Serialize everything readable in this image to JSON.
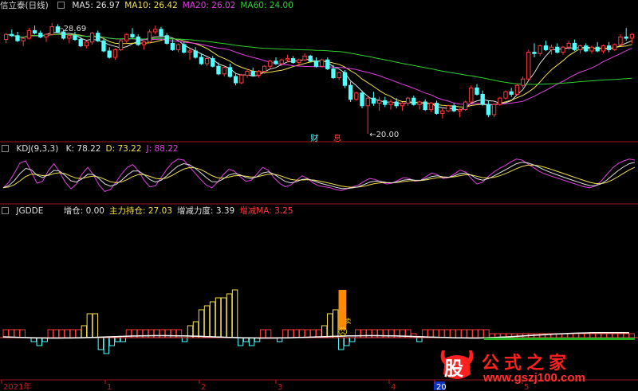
{
  "colors": {
    "up": "#ff3a3a",
    "down": "#54ffff",
    "ma5": "#e0e0e0",
    "ma10": "#f2e04a",
    "ma20": "#e040e0",
    "ma60": "#30d030",
    "kdj_k": "#e0e0e0",
    "kdj_d": "#f2e04a",
    "kdj_j": "#e040e0",
    "separator": "#a01818",
    "axis_text": "#c02020"
  },
  "main_panel": {
    "title": "信立泰(日线)",
    "indicators": [
      {
        "label": "MA5: 26.97",
        "color": "#e0e0e0"
      },
      {
        "label": "MA10: 26.42",
        "color": "#f2e04a"
      },
      {
        "label": "MA20: 26.02",
        "color": "#e040e0"
      },
      {
        "label": "MA60: 24.00",
        "color": "#30d030"
      }
    ],
    "high_marker": "28.69",
    "low_marker": "20.00",
    "event_labels": [
      {
        "text": "财",
        "color": "#54ffff"
      },
      {
        "text": "息",
        "color": "#ff3a3a"
      }
    ]
  },
  "kdj_panel": {
    "title": "KDJ(9,3,3)",
    "indicators": [
      {
        "label": "K: 78.22",
        "color": "#e0e0e0"
      },
      {
        "label": "D: 73.22",
        "color": "#f2e04a"
      },
      {
        "label": "J: 88.22",
        "color": "#e040e0"
      }
    ]
  },
  "jgdde_panel": {
    "title": "JGDDE",
    "indicators": [
      {
        "label": "增仓: 0.00",
        "color": "#e0e0e0"
      },
      {
        "label": "主力持仓: 27.03",
        "color": "#f2e04a"
      },
      {
        "label": "增减力度: 3.39",
        "color": "#e0e0e0"
      },
      {
        "label": "增减MA: 3.25",
        "color": "#ff3a3a"
      }
    ],
    "marker_glyph": "☹",
    "marker_label": "卖"
  },
  "time_axis": {
    "labels": [
      "2021年",
      "1",
      "2",
      "3",
      "4",
      "20",
      "5"
    ],
    "highlight_index": 5
  },
  "watermark": {
    "logo_char": "股",
    "text": "公式之家",
    "url": "www.gszj100.com"
  },
  "chart_data": {
    "type": "candlestick",
    "title": "信立泰(日线)",
    "price_range": [
      19.5,
      29.5
    ],
    "anchors": {
      "high": 28.69,
      "low": 20.0
    },
    "ma_last": {
      "MA5": 26.97,
      "MA10": 26.42,
      "MA20": 26.02,
      "MA60": 24.0
    },
    "candles": [
      [
        27.4,
        27.9,
        27.1,
        27.8
      ],
      [
        27.8,
        28.2,
        27.6,
        27.7
      ],
      [
        27.7,
        28.0,
        27.2,
        27.3
      ],
      [
        27.3,
        27.6,
        26.9,
        27.5
      ],
      [
        27.5,
        28.3,
        27.4,
        28.1
      ],
      [
        28.1,
        28.5,
        27.8,
        27.9
      ],
      [
        27.9,
        28.1,
        27.5,
        27.6
      ],
      [
        27.6,
        27.9,
        27.2,
        27.8
      ],
      [
        27.8,
        28.69,
        27.7,
        28.4
      ],
      [
        28.4,
        28.6,
        27.9,
        28.0
      ],
      [
        28.0,
        28.2,
        27.4,
        27.5
      ],
      [
        27.5,
        27.8,
        27.1,
        27.7
      ],
      [
        27.7,
        28.0,
        27.3,
        27.4
      ],
      [
        27.4,
        27.6,
        26.8,
        26.9
      ],
      [
        26.9,
        27.3,
        26.7,
        27.2
      ],
      [
        27.2,
        28.0,
        27.0,
        27.9
      ],
      [
        27.9,
        28.1,
        27.2,
        27.3
      ],
      [
        27.3,
        27.5,
        26.4,
        26.5
      ],
      [
        26.5,
        26.8,
        25.9,
        26.0
      ],
      [
        26.0,
        26.7,
        25.8,
        26.6
      ],
      [
        26.6,
        27.4,
        26.5,
        27.3
      ],
      [
        27.3,
        27.9,
        27.1,
        27.8
      ],
      [
        27.8,
        28.3,
        27.5,
        27.6
      ],
      [
        27.6,
        27.8,
        26.9,
        27.0
      ],
      [
        27.0,
        27.3,
        26.6,
        27.2
      ],
      [
        27.2,
        28.2,
        27.1,
        28.0
      ],
      [
        28.0,
        28.5,
        27.8,
        28.2
      ],
      [
        28.2,
        28.4,
        27.6,
        27.7
      ],
      [
        27.7,
        27.9,
        27.0,
        27.1
      ],
      [
        27.1,
        27.4,
        26.5,
        26.6
      ],
      [
        26.6,
        27.1,
        26.4,
        27.0
      ],
      [
        27.0,
        27.2,
        26.3,
        26.4
      ],
      [
        26.4,
        26.7,
        25.8,
        26.5
      ],
      [
        26.5,
        26.8,
        25.9,
        26.0
      ],
      [
        26.0,
        26.3,
        25.4,
        25.5
      ],
      [
        25.5,
        26.0,
        25.3,
        25.9
      ],
      [
        25.9,
        26.1,
        25.2,
        25.3
      ],
      [
        25.3,
        25.6,
        24.6,
        24.7
      ],
      [
        24.7,
        25.3,
        24.5,
        25.2
      ],
      [
        25.2,
        25.5,
        24.4,
        24.5
      ],
      [
        24.5,
        24.8,
        23.8,
        24.0
      ],
      [
        24.0,
        24.7,
        23.9,
        24.6
      ],
      [
        24.6,
        25.1,
        24.4,
        24.9
      ],
      [
        24.9,
        25.2,
        24.5,
        24.6
      ],
      [
        24.6,
        25.0,
        24.4,
        24.9
      ],
      [
        24.9,
        25.4,
        24.7,
        25.3
      ],
      [
        25.3,
        25.8,
        25.1,
        25.7
      ],
      [
        25.7,
        26.0,
        25.4,
        25.5
      ],
      [
        25.5,
        25.9,
        25.3,
        25.8
      ],
      [
        25.8,
        26.2,
        25.6,
        25.9
      ],
      [
        25.9,
        26.1,
        25.5,
        25.6
      ],
      [
        25.6,
        25.9,
        25.3,
        25.8
      ],
      [
        25.8,
        26.3,
        25.7,
        26.1
      ],
      [
        26.1,
        26.2,
        25.6,
        25.7
      ],
      [
        25.7,
        26.0,
        25.2,
        25.3
      ],
      [
        25.3,
        25.9,
        25.2,
        25.8
      ],
      [
        25.8,
        26.0,
        25.0,
        25.1
      ],
      [
        25.1,
        25.4,
        24.3,
        24.4
      ],
      [
        24.4,
        24.9,
        24.2,
        24.8
      ],
      [
        24.8,
        25.0,
        23.6,
        23.8
      ],
      [
        23.8,
        24.1,
        22.5,
        22.7
      ],
      [
        22.7,
        23.3,
        22.6,
        23.2
      ],
      [
        23.2,
        23.4,
        22.0,
        22.2
      ],
      [
        22.2,
        23.0,
        20.0,
        22.8
      ],
      [
        22.8,
        23.3,
        22.2,
        22.4
      ],
      [
        22.4,
        22.9,
        21.8,
        22.6
      ],
      [
        22.6,
        22.9,
        22.1,
        22.3
      ],
      [
        22.3,
        22.7,
        21.9,
        22.5
      ],
      [
        22.5,
        22.8,
        22.0,
        22.2
      ],
      [
        22.2,
        22.5,
        21.8,
        22.4
      ],
      [
        22.4,
        22.9,
        22.2,
        22.8
      ],
      [
        22.8,
        23.0,
        22.2,
        22.3
      ],
      [
        22.3,
        22.6,
        21.9,
        22.5
      ],
      [
        22.5,
        22.7,
        21.8,
        21.9
      ],
      [
        21.9,
        22.5,
        21.7,
        22.4
      ],
      [
        22.4,
        22.6,
        21.5,
        21.6
      ],
      [
        21.6,
        22.0,
        21.2,
        21.8
      ],
      [
        21.8,
        22.3,
        21.7,
        22.2
      ],
      [
        22.2,
        22.4,
        21.7,
        21.8
      ],
      [
        21.8,
        22.0,
        21.3,
        21.9
      ],
      [
        21.9,
        22.6,
        21.8,
        22.5
      ],
      [
        22.5,
        23.8,
        22.4,
        23.6
      ],
      [
        23.6,
        23.9,
        23.0,
        23.1
      ],
      [
        23.1,
        23.4,
        22.2,
        22.3
      ],
      [
        22.3,
        22.6,
        21.3,
        21.5
      ],
      [
        21.5,
        22.4,
        21.3,
        22.3
      ],
      [
        22.3,
        22.9,
        22.2,
        22.8
      ],
      [
        22.8,
        23.4,
        22.7,
        23.3
      ],
      [
        23.3,
        23.6,
        22.9,
        23.1
      ],
      [
        23.1,
        23.9,
        23.0,
        23.8
      ],
      [
        23.8,
        24.5,
        23.6,
        24.3
      ],
      [
        24.3,
        26.6,
        24.2,
        26.4
      ],
      [
        26.4,
        27.1,
        26.0,
        26.3
      ],
      [
        26.3,
        27.0,
        26.1,
        26.9
      ],
      [
        26.9,
        27.3,
        26.5,
        26.6
      ],
      [
        26.6,
        27.0,
        26.2,
        26.8
      ],
      [
        26.8,
        27.1,
        26.3,
        26.4
      ],
      [
        26.4,
        26.9,
        26.2,
        26.8
      ],
      [
        26.8,
        27.3,
        26.6,
        27.1
      ],
      [
        27.1,
        27.4,
        26.5,
        26.6
      ],
      [
        26.6,
        27.0,
        26.3,
        26.9
      ],
      [
        26.9,
        27.1,
        26.4,
        26.5
      ],
      [
        26.5,
        26.9,
        26.3,
        26.8
      ],
      [
        26.8,
        27.2,
        26.4,
        26.5
      ],
      [
        26.5,
        27.0,
        26.3,
        26.9
      ],
      [
        26.9,
        27.2,
        26.4,
        26.6
      ],
      [
        26.6,
        27.1,
        26.5,
        27.0
      ],
      [
        27.0,
        27.8,
        26.9,
        27.6
      ],
      [
        27.6,
        28.3,
        27.3,
        27.5
      ],
      [
        27.5,
        27.9,
        27.1,
        27.8
      ]
    ],
    "kdj": {
      "range": [
        0,
        100
      ],
      "k_last": 78.22,
      "d_last": 73.22,
      "j_last": 88.22,
      "j": [
        28,
        40,
        60,
        82,
        86,
        62,
        38,
        42,
        65,
        80,
        62,
        40,
        26,
        36,
        58,
        72,
        56,
        34,
        20,
        24,
        40,
        58,
        72,
        78,
        64,
        44,
        30,
        32,
        50,
        68,
        82,
        90,
        88,
        74,
        60,
        46,
        34,
        28,
        40,
        56,
        68,
        64,
        52,
        42,
        44,
        58,
        72,
        66,
        50,
        38,
        30,
        34,
        44,
        54,
        48,
        38,
        32,
        30,
        28,
        24,
        22,
        26,
        30,
        34,
        42,
        48,
        46,
        40,
        36,
        38,
        44,
        50,
        48,
        42,
        44,
        52,
        60,
        56,
        48,
        50,
        58,
        66,
        62,
        48,
        36,
        40,
        52,
        62,
        70,
        76,
        84,
        90,
        88,
        80,
        72,
        64,
        58,
        54,
        50,
        46,
        42,
        38,
        34,
        30,
        28,
        32,
        42,
        56,
        70,
        80,
        86,
        90,
        88
      ]
    },
    "jgdde": {
      "zengcang_last": 0.0,
      "zhuli_chicang_last": 27.03,
      "lidu_last": 3.39,
      "ma_last": 3.25,
      "bars": [
        2,
        2,
        2,
        2,
        0,
        -1,
        -2,
        -1,
        2,
        2,
        2,
        2,
        2,
        2,
        3,
        6,
        6,
        -3,
        -4,
        -2,
        -1,
        -1,
        2,
        2,
        2,
        2,
        2,
        2,
        2,
        2,
        2,
        2,
        -1,
        3,
        4,
        7,
        8,
        9,
        10,
        10,
        11,
        12,
        -2,
        -1,
        -2,
        -1,
        2,
        2,
        0,
        -1,
        2,
        2,
        2,
        2,
        2,
        2,
        2,
        3,
        6,
        7,
        -3,
        -2,
        -1,
        2,
        2,
        2,
        2,
        2,
        2,
        2,
        2,
        2,
        2,
        1,
        -1,
        2,
        2,
        2,
        2,
        2,
        2,
        2,
        2,
        2,
        2,
        2,
        2,
        1,
        1,
        1,
        1,
        1,
        1,
        1,
        1,
        1,
        1,
        1,
        1,
        1,
        1,
        1,
        1,
        1,
        1,
        1,
        1,
        1,
        1,
        1,
        1,
        1,
        1
      ]
    }
  }
}
